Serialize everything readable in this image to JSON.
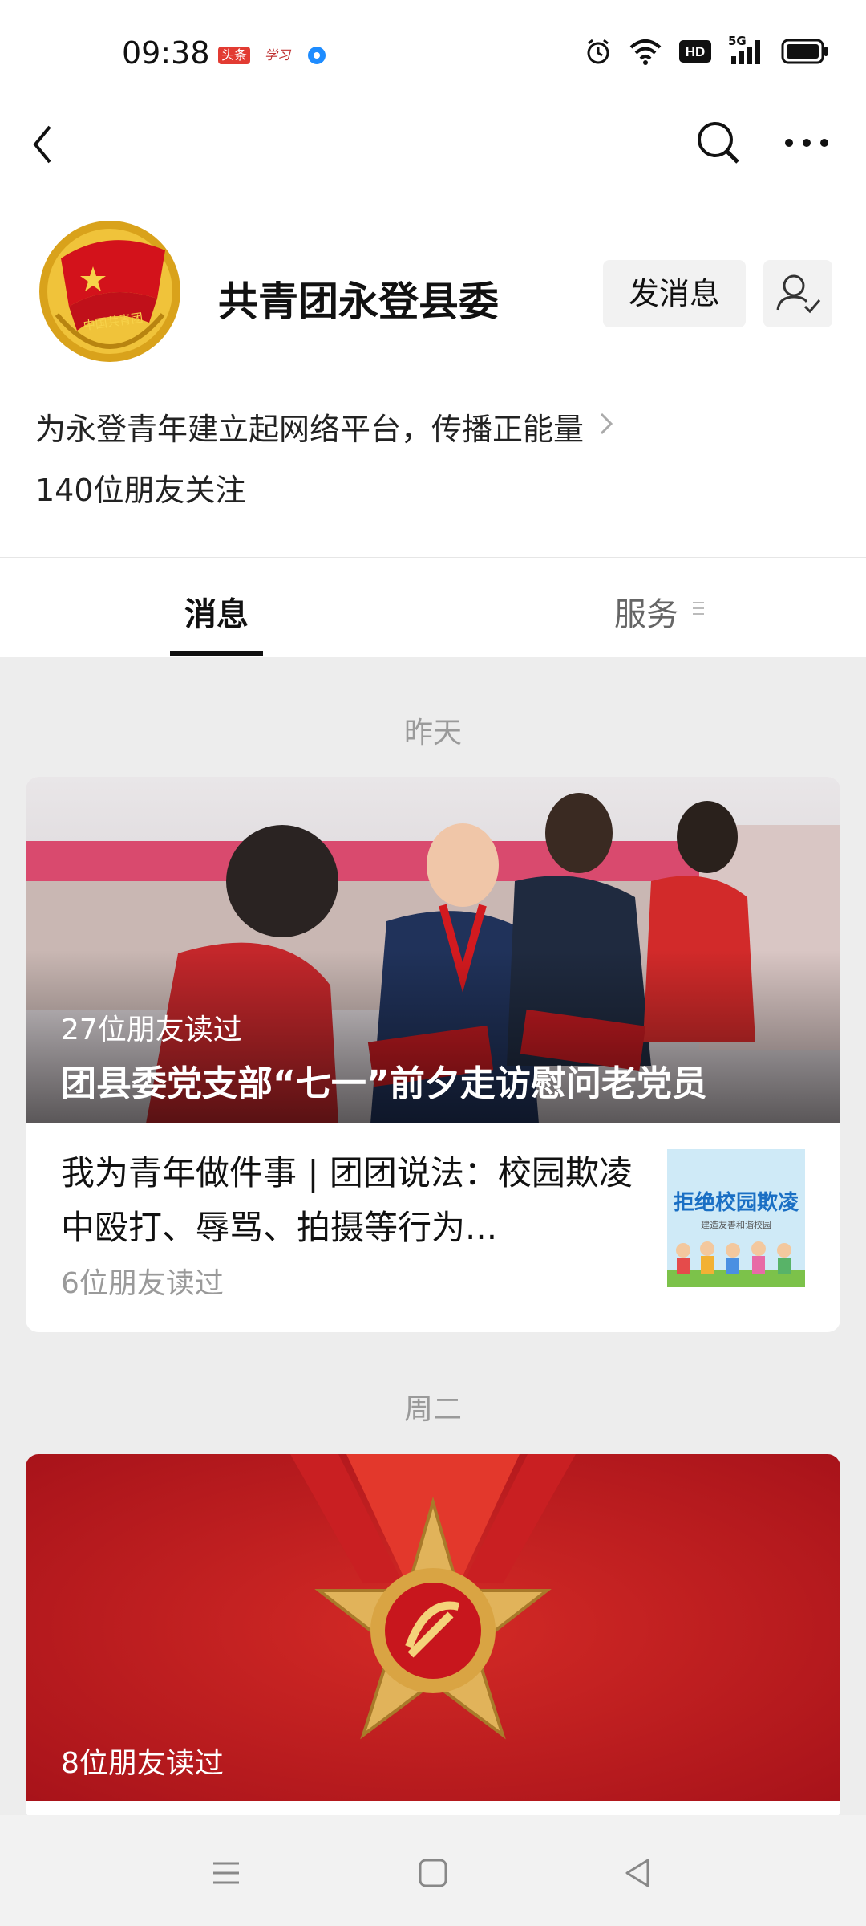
{
  "status_bar": {
    "time": "09:38",
    "badge1": "头条",
    "badge2": "学习",
    "network": "5G"
  },
  "account": {
    "name": "共青团永登县委",
    "send_message_label": "发消息",
    "description": "为永登青年建立起网络平台，传播正能量",
    "followers": "140位朋友关注",
    "logo_text": "中国共青团"
  },
  "tabs": [
    {
      "label": "消息"
    },
    {
      "label": "服务"
    }
  ],
  "feed": [
    {
      "date": "昨天",
      "hero": {
        "read_count": "27位朋友读过",
        "title": "团县委党支部“七一”前夕走访慰问老党员"
      },
      "sub": {
        "title": "我为青年做件事 | 团团说法：校园欺凌中殴打、辱骂、拍摄等行为...",
        "read_count": "6位朋友读过",
        "thumb_title": "拒绝校园欺凌",
        "thumb_sub": "建造友善和谐校园"
      }
    },
    {
      "date": "周二",
      "hero": {
        "read_count": "8位朋友读过"
      }
    }
  ]
}
